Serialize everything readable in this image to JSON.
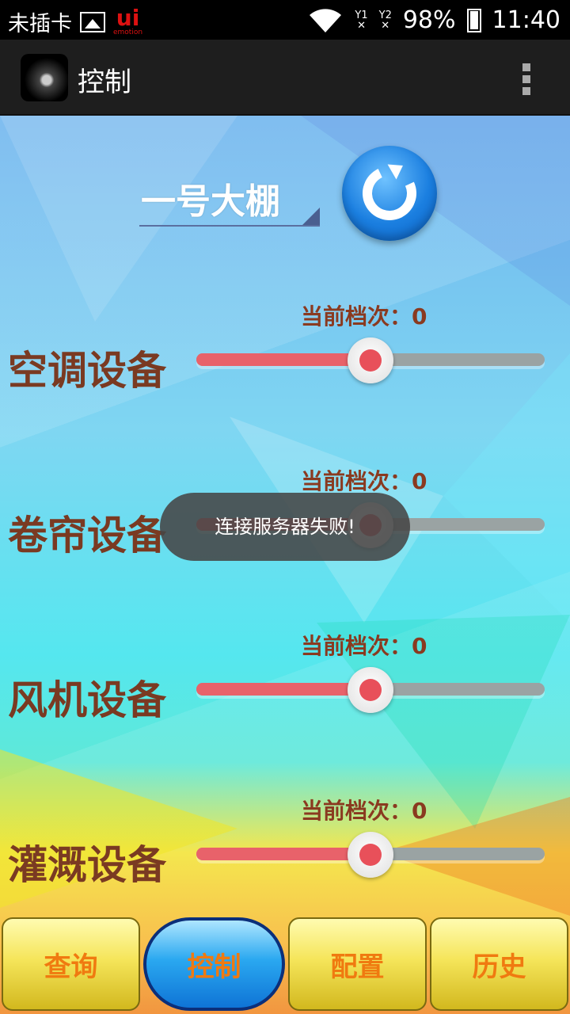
{
  "status_bar": {
    "carrier": "未插卡",
    "brand": "ui",
    "brand_sub": "emotion",
    "signal1": "Y1",
    "signal2": "Y2",
    "battery": "98%",
    "time": "11:40"
  },
  "action_bar": {
    "title": "控制"
  },
  "greenhouse_select": {
    "selected": "一号大棚"
  },
  "devices": [
    {
      "label": "空调设备",
      "level_text": "当前档次：0",
      "slider_position": 0.5
    },
    {
      "label": "卷帘设备",
      "level_text": "当前档次：0",
      "slider_position": 0.5
    },
    {
      "label": "风机设备",
      "level_text": "当前档次：0",
      "slider_position": 0.5
    },
    {
      "label": "灌溉设备",
      "level_text": "当前档次：0",
      "slider_position": 0.5
    }
  ],
  "toast": "连接服务器失败!",
  "tabs": [
    {
      "label": "查询",
      "active": false
    },
    {
      "label": "控制",
      "active": true
    },
    {
      "label": "配置",
      "active": false
    },
    {
      "label": "历史",
      "active": false
    }
  ],
  "colors": {
    "device_label": "#7a3a22",
    "slider_fill": "#e8626a",
    "tab_text": "#f07a10",
    "active_tab": "#1b8fe6"
  }
}
